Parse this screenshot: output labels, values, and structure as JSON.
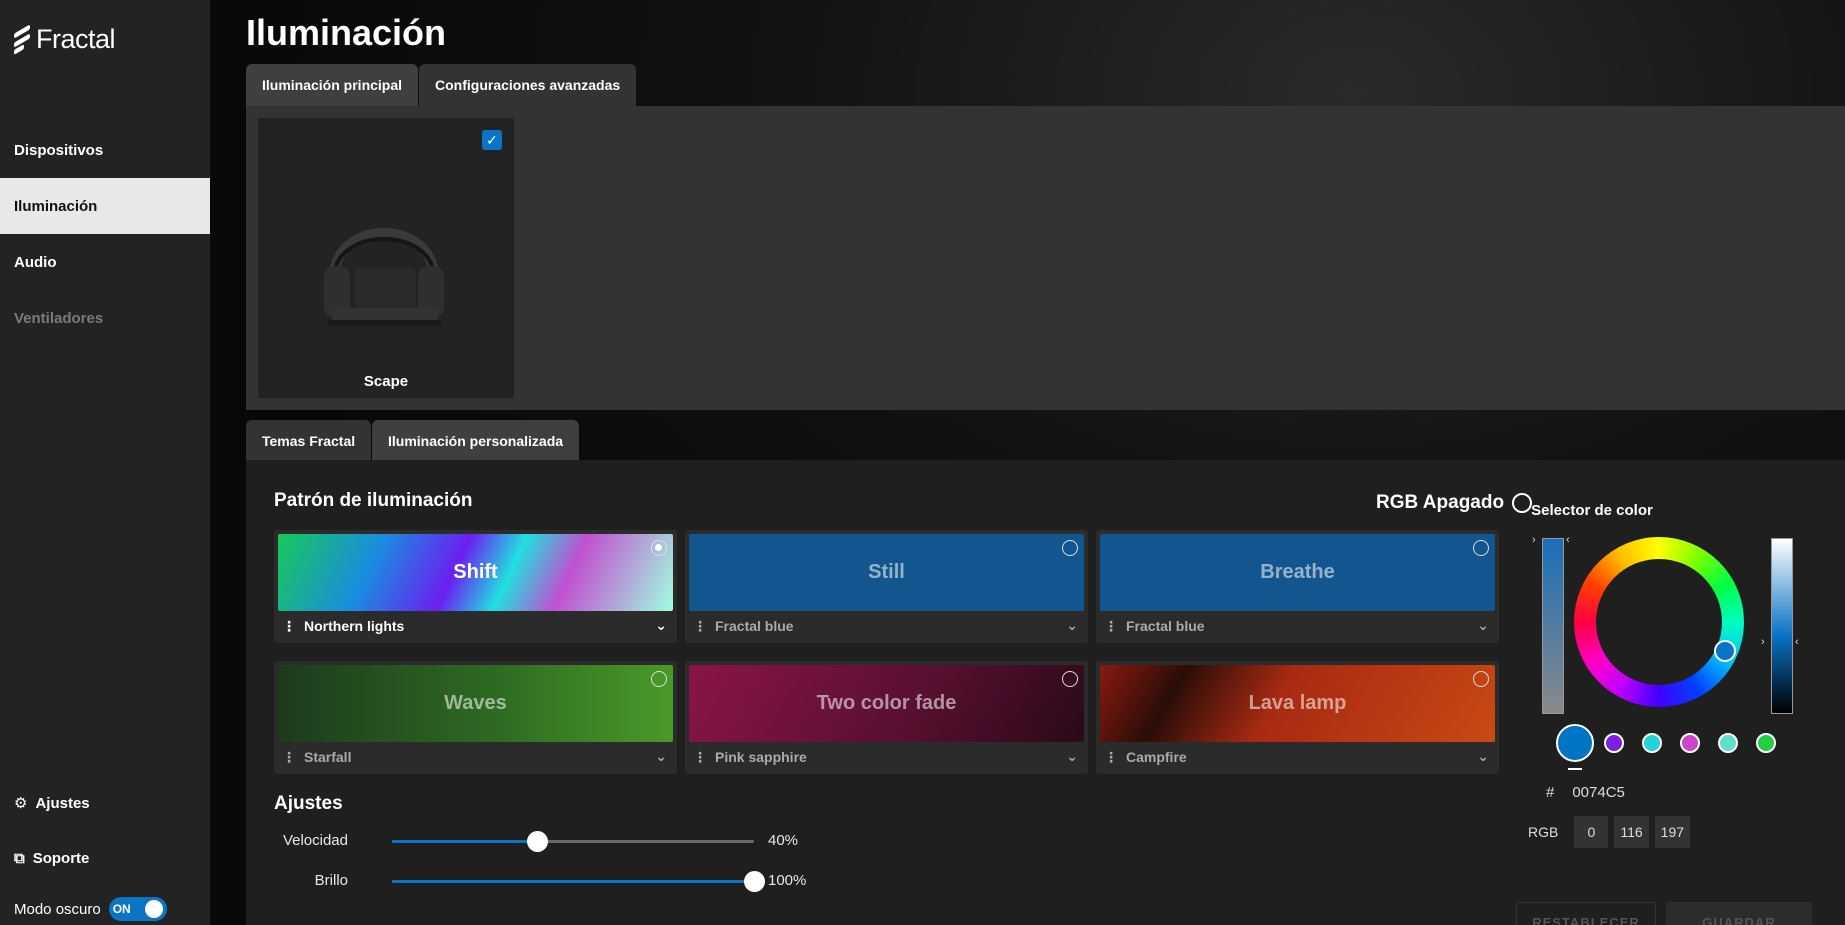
{
  "sidebar": {
    "logo_text": "Fractal",
    "items": [
      {
        "label": "Dispositivos"
      },
      {
        "label": "Iluminación"
      },
      {
        "label": "Audio"
      },
      {
        "label": "Ventiladores"
      }
    ],
    "settings_label": "Ajustes",
    "support_label": "Soporte",
    "dark_mode_label": "Modo oscuro",
    "dark_mode_state": "ON"
  },
  "page": {
    "title": "Iluminación",
    "tabs": [
      {
        "label": "Iluminación principal"
      },
      {
        "label": "Configuraciones avanzadas"
      }
    ],
    "device": {
      "name": "Scape",
      "checkbox_mark": "✓"
    },
    "sub_tabs": [
      {
        "label": "Temas Fractal"
      },
      {
        "label": "Iluminación personalizada"
      }
    ]
  },
  "pattern": {
    "title": "Patrón de iluminación",
    "rgb_off_label": "RGB Apagado",
    "items": [
      {
        "name": "Shift",
        "preset": "Northern lights",
        "selected": true
      },
      {
        "name": "Still",
        "preset": "Fractal blue",
        "selected": false
      },
      {
        "name": "Breathe",
        "preset": "Fractal blue",
        "selected": false
      },
      {
        "name": "Waves",
        "preset": "Starfall",
        "selected": false
      },
      {
        "name": "Two color fade",
        "preset": "Pink sapphire",
        "selected": false
      },
      {
        "name": "Lava lamp",
        "preset": "Campfire",
        "selected": false
      }
    ]
  },
  "adjustments": {
    "title": "Ajustes",
    "speed": {
      "label": "Velocidad",
      "value": 40,
      "display": "40%"
    },
    "brightness": {
      "label": "Brillo",
      "value": 100,
      "display": "100%"
    }
  },
  "color_picker": {
    "title": "Selector de color",
    "hex_prefix": "#",
    "hex": "0074C5",
    "rgb_label": "RGB",
    "r": "0",
    "g": "116",
    "b": "197",
    "accent": "#0a74c5",
    "presets": [
      "#0074C5",
      "#7b1fe0",
      "#1fd3d8",
      "#cc44cc",
      "#5fe0c8",
      "#20d040"
    ],
    "reset_label": "RESTABLECER",
    "save_label": "GUARDAR"
  }
}
